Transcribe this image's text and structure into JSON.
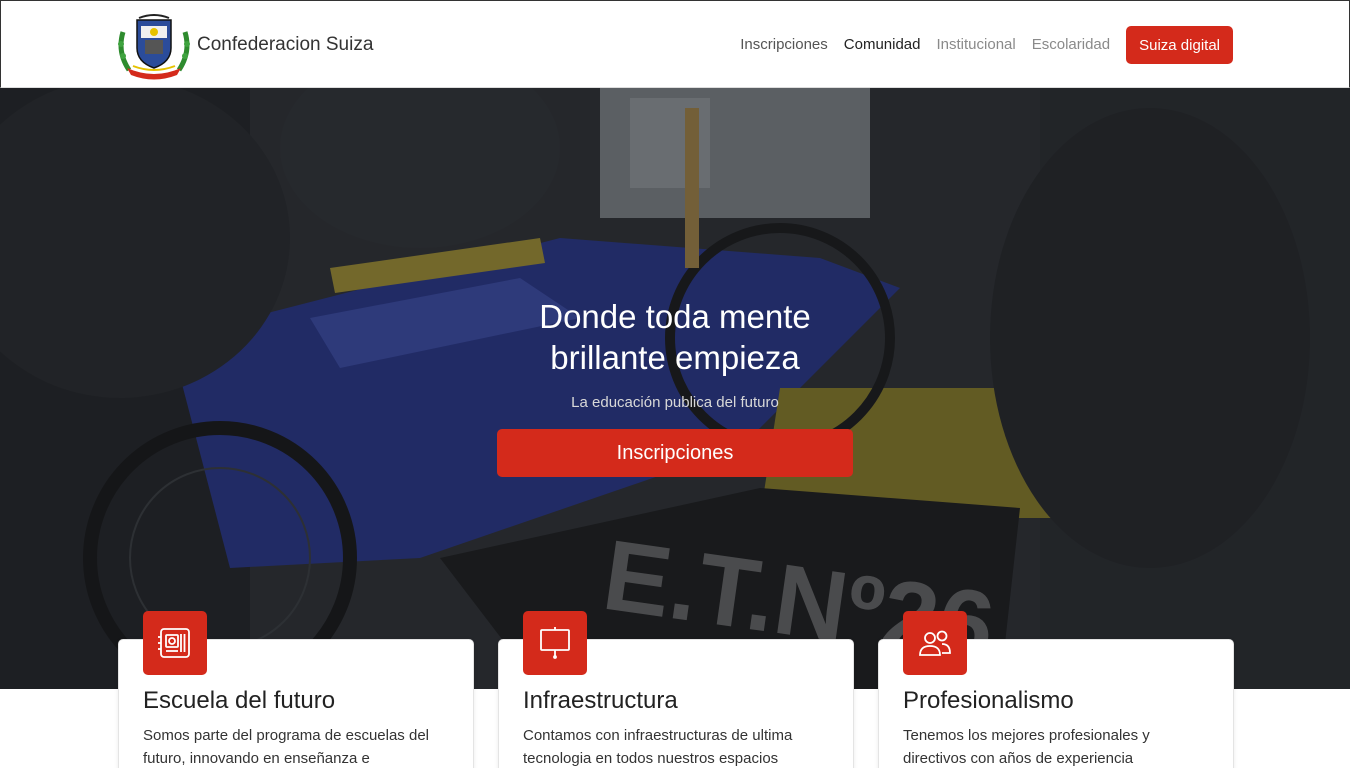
{
  "brand": {
    "name": "Confederacion Suiza"
  },
  "nav": {
    "items": [
      {
        "label": "Inscripciones",
        "state": "normal"
      },
      {
        "label": "Comunidad",
        "state": "active"
      },
      {
        "label": "Institucional",
        "state": "muted"
      },
      {
        "label": "Escolaridad",
        "state": "muted"
      }
    ],
    "cta_label": "Suiza digital"
  },
  "hero": {
    "title": "Donde toda mente brillante empieza",
    "subtitle": "La educación publica del futuro",
    "button_label": "Inscripciones"
  },
  "features": [
    {
      "icon": "motherboard-icon",
      "title": "Escuela del futuro",
      "text": "Somos parte del programa de escuelas del futuro, innovando en enseñanza e"
    },
    {
      "icon": "presentation-board-icon",
      "title": "Infraestructura",
      "text": "Contamos con infraestructuras de ultima tecnologia en todos nuestros espacios"
    },
    {
      "icon": "people-icon",
      "title": "Profesionalismo",
      "text": "Tenemos los mejores profesionales y directivos con años de experiencia"
    }
  ],
  "colors": {
    "accent": "#d42a1b",
    "hero_overlay": "#1f2226",
    "text": "#212529"
  }
}
